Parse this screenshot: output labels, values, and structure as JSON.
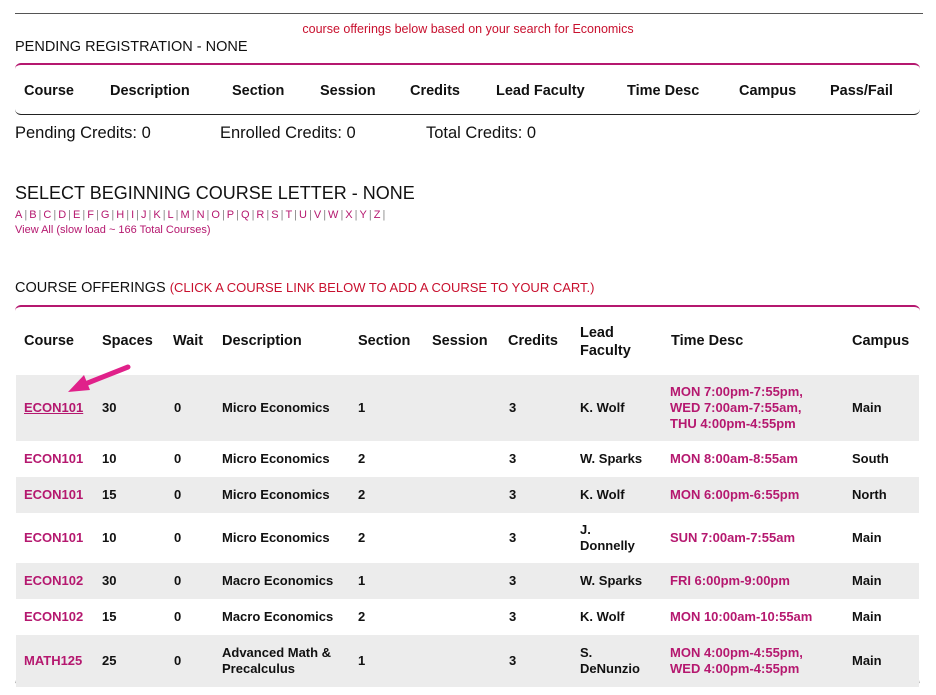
{
  "search_note": "course offerings below based on your search for Economics",
  "pending": {
    "title": "PENDING REGISTRATION - NONE",
    "columns": [
      "Course",
      "Description",
      "Section",
      "Session",
      "Credits",
      "Lead Faculty",
      "Time Desc",
      "Campus",
      "Pass/Fail"
    ]
  },
  "credits": {
    "pending": "Pending Credits: 0",
    "enrolled": "Enrolled Credits: 0",
    "total": "Total Credits: 0"
  },
  "letter_select": {
    "title": "SELECT BEGINNING COURSE LETTER - NONE",
    "letters": [
      "A",
      "B",
      "C",
      "D",
      "E",
      "F",
      "G",
      "H",
      "I",
      "J",
      "K",
      "L",
      "M",
      "N",
      "O",
      "P",
      "Q",
      "R",
      "S",
      "T",
      "U",
      "V",
      "W",
      "X",
      "Y",
      "Z"
    ],
    "view_all": "View All (slow load ~ 166 Total Courses)"
  },
  "offerings": {
    "title": "COURSE OFFERINGS",
    "hint": "(CLICK A COURSE LINK BELOW TO ADD A COURSE TO YOUR CART.)",
    "columns": [
      "Course",
      "Spaces",
      "Wait",
      "Description",
      "Section",
      "Session",
      "Credits",
      "Lead\nFaculty",
      "Time Desc",
      "Campus"
    ],
    "rows": [
      {
        "course": "ECON101",
        "spaces": "30",
        "wait": "0",
        "description": "Micro Economics",
        "section": "1",
        "session": "",
        "credits": "3",
        "faculty": "K. Wolf",
        "time": "MON 7:00pm-7:55pm,\nWED 7:00am-7:55am,\nTHU 4:00pm-4:55pm",
        "campus": "Main"
      },
      {
        "course": "ECON101",
        "spaces": "10",
        "wait": "0",
        "description": "Micro Economics",
        "section": "2",
        "session": "",
        "credits": "3",
        "faculty": "W. Sparks",
        "time": "MON 8:00am-8:55am",
        "campus": "South"
      },
      {
        "course": "ECON101",
        "spaces": "15",
        "wait": "0",
        "description": "Micro Economics",
        "section": "2",
        "session": "",
        "credits": "3",
        "faculty": "K. Wolf",
        "time": "MON 6:00pm-6:55pm",
        "campus": "North"
      },
      {
        "course": "ECON101",
        "spaces": "10",
        "wait": "0",
        "description": "Micro Economics",
        "section": "2",
        "session": "",
        "credits": "3",
        "faculty": "J.\nDonnelly",
        "time": "SUN 7:00am-7:55am",
        "campus": "Main"
      },
      {
        "course": "ECON102",
        "spaces": "30",
        "wait": "0",
        "description": "Macro Economics",
        "section": "1",
        "session": "",
        "credits": "3",
        "faculty": "W. Sparks",
        "time": "FRI 6:00pm-9:00pm",
        "campus": "Main"
      },
      {
        "course": "ECON102",
        "spaces": "15",
        "wait": "0",
        "description": "Macro Economics",
        "section": "2",
        "session": "",
        "credits": "3",
        "faculty": "K. Wolf",
        "time": "MON 10:00am-10:55am",
        "campus": "Main"
      },
      {
        "course": "MATH125",
        "spaces": "25",
        "wait": "0",
        "description": "Advanced Math &\nPrecalculus",
        "section": "1",
        "session": "",
        "credits": "3",
        "faculty": "S.\nDeNunzio",
        "time": "MON 4:00pm-4:55pm,\nWED 4:00pm-4:55pm",
        "campus": "Main"
      }
    ]
  },
  "colors": {
    "accent": "#b5186f",
    "alert": "#c8102e",
    "row_alt": "#ececec"
  }
}
